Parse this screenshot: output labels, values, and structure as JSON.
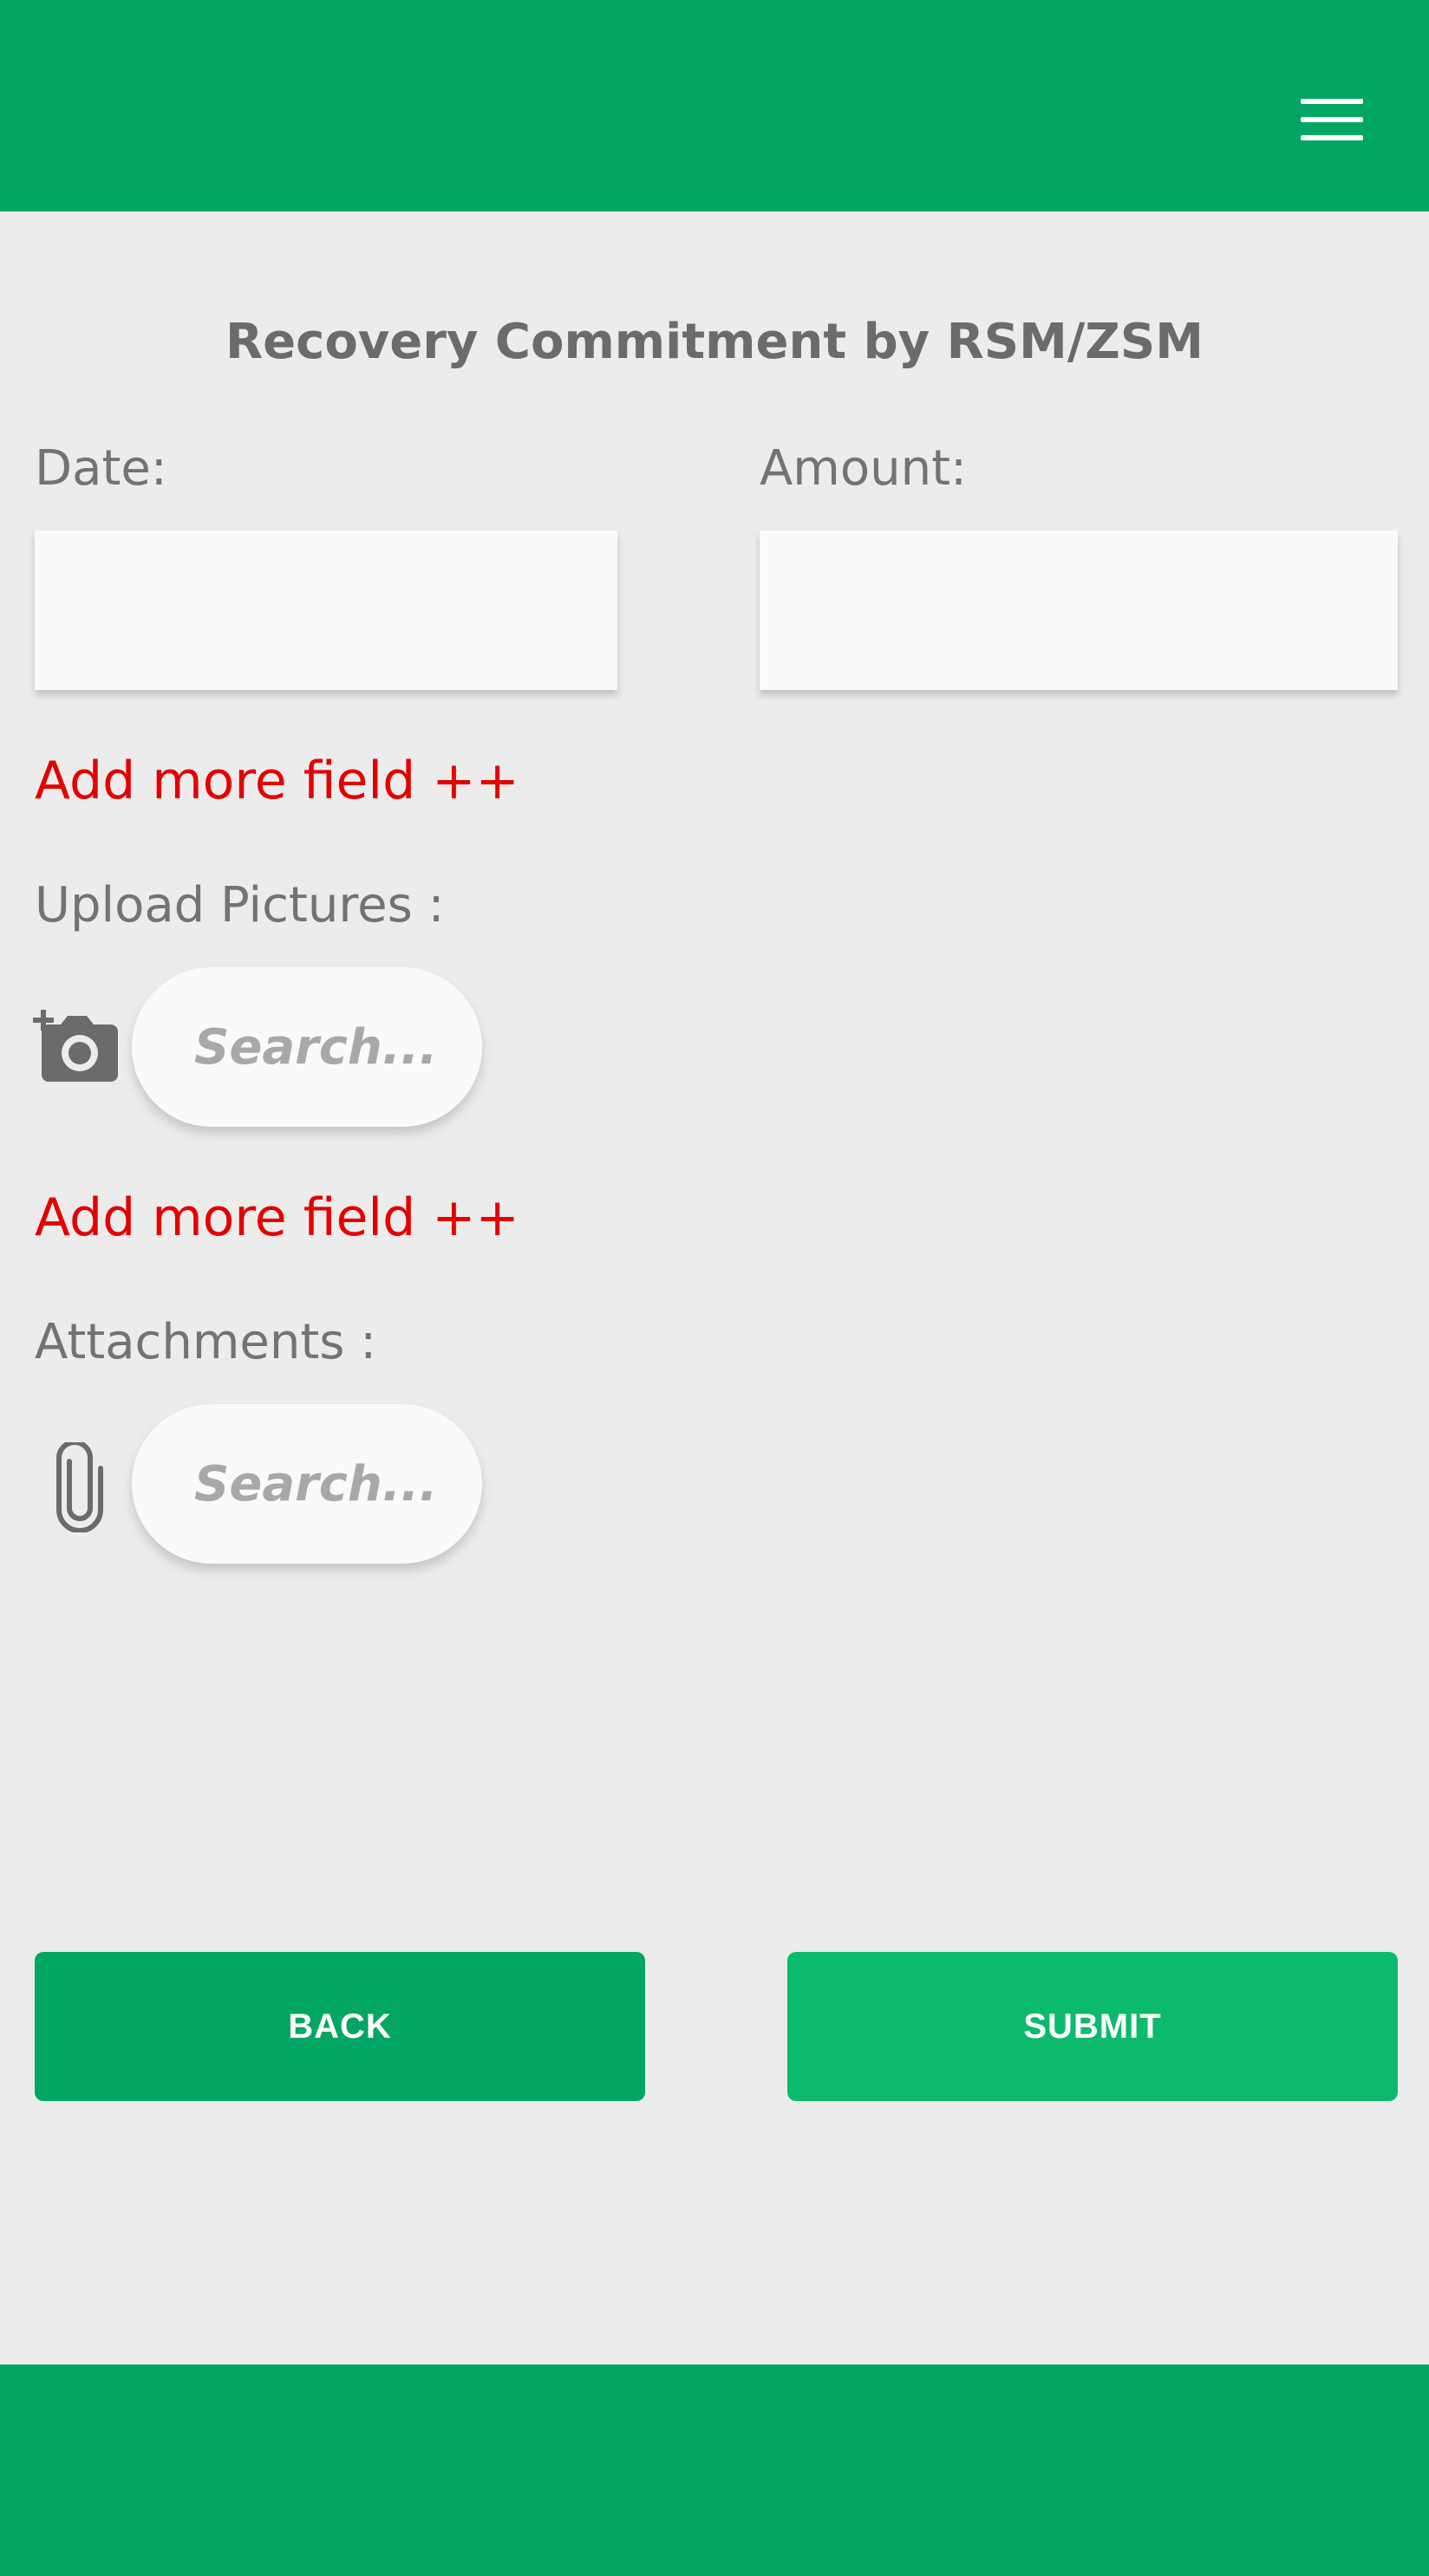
{
  "header": {
    "menu_icon": "hamburger-menu-icon"
  },
  "form": {
    "title": "Recovery Commitment by RSM/ZSM",
    "date_label": "Date:",
    "date_value": "",
    "amount_label": "Amount:",
    "amount_value": "",
    "add_more_label": "Add more field ++",
    "upload_label": "Upload Pictures :",
    "upload_icon": "add-camera-icon",
    "upload_placeholder": "Search...",
    "add_more_label_2": "Add more field ++",
    "attachments_label": "Attachments :",
    "attachments_icon": "paperclip-icon",
    "attachments_placeholder": "Search..."
  },
  "actions": {
    "back_label": "BACK",
    "submit_label": "SUBMIT"
  },
  "colors": {
    "brand_green": "#00a661",
    "submit_green": "#0bba6d",
    "link_red": "#e50000",
    "background": "#ececec"
  }
}
